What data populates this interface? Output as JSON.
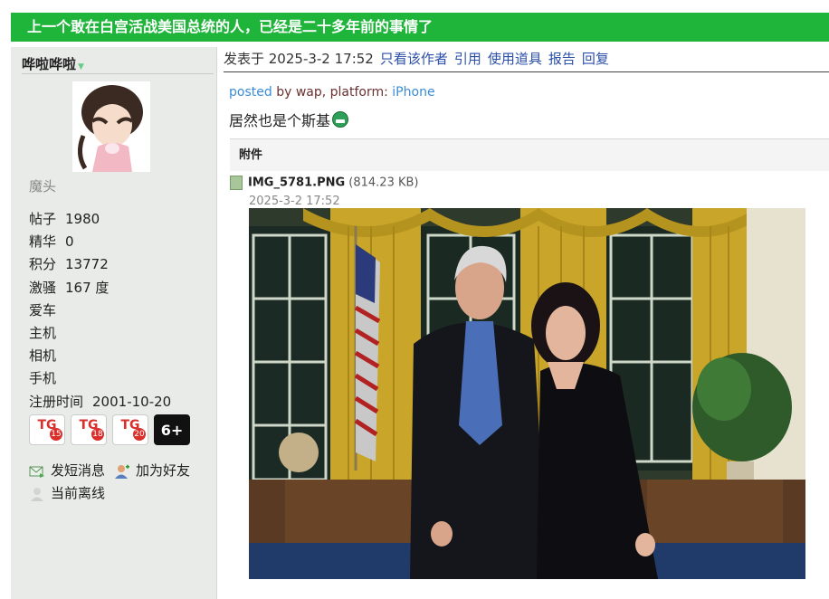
{
  "thread_title": "上一个敢在白宫活战美国总统的人，已经是二十多年前的事情了",
  "user": {
    "name": "哗啦哗啦",
    "rank": "魔头",
    "stats": [
      {
        "label": "帖子",
        "value": "1980"
      },
      {
        "label": "精华",
        "value": "0"
      },
      {
        "label": "积分",
        "value": "13772"
      },
      {
        "label": "激骚",
        "value": "167 度"
      },
      {
        "label": "爱车",
        "value": ""
      },
      {
        "label": "主机",
        "value": ""
      },
      {
        "label": "相机",
        "value": ""
      },
      {
        "label": "手机",
        "value": ""
      },
      {
        "label": "注册时间",
        "value": "2001-10-20"
      }
    ],
    "badges": [
      {
        "text": "TG",
        "num": "15"
      },
      {
        "text": "TG",
        "num": "18"
      },
      {
        "text": "TG",
        "num": "20"
      },
      {
        "text": "6+",
        "num": ""
      }
    ],
    "actions": {
      "message": "发短消息",
      "add_friend": "加为好友",
      "status": "当前离线"
    }
  },
  "post": {
    "date": "发表于 2025-3-2 17:52",
    "links": [
      "只看该作者",
      "引用",
      "使用道具",
      "报告",
      "回复"
    ],
    "posted_word": "posted",
    "by_text": " by wap, platform: ",
    "platform": "iPhone",
    "content": "居然也是个斯基",
    "attachment_header": "附件",
    "file_name": "IMG_5781.PNG",
    "file_size": " (814.23 KB)",
    "file_date": "2025-3-2 17:52"
  },
  "colors": {
    "title_bar": "#1fb53a",
    "sidebar": "#e9ebe9",
    "link": "#2b4fa8",
    "posted_blue": "#3b8bd6",
    "badge_red": "#d9302c"
  }
}
